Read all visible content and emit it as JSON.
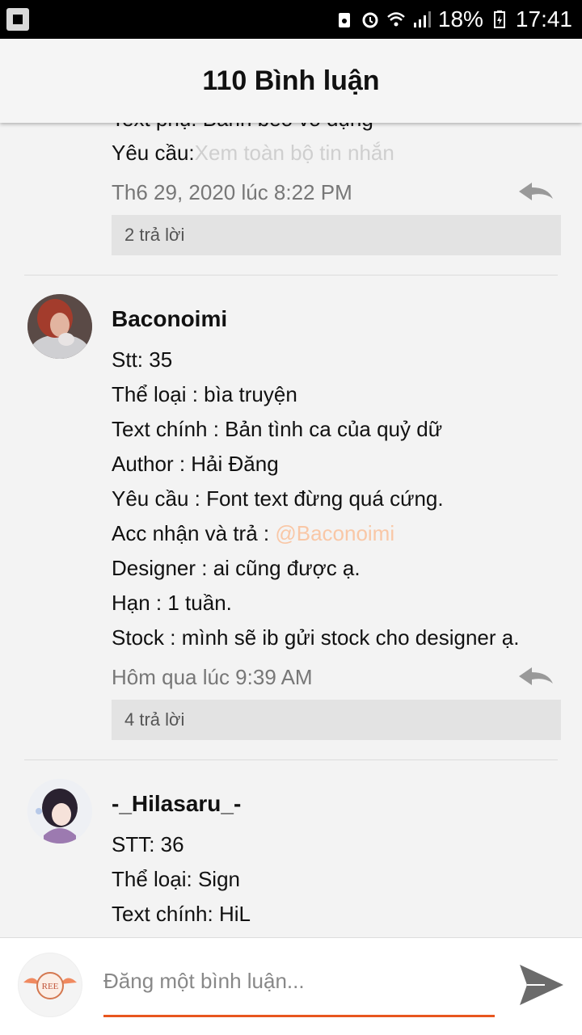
{
  "status_bar": {
    "battery": "18%",
    "time": "17:41"
  },
  "header": {
    "title": "110 Bình luận"
  },
  "comments": [
    {
      "partial_line": "Text phụ: Bánh bèo vô dụng",
      "request_label": "Yêu cầu:",
      "view_all": "Xem toàn bộ tin nhắn",
      "time": "Th6 29, 2020 lúc 8:22 PM",
      "replies": "2 trả lời"
    },
    {
      "user": "Baconoimi",
      "lines": [
        "Stt: 35",
        "Thể loại : bìa truyện",
        "Text chính : Bản tình ca của quỷ dữ",
        "Author : Hải Đăng",
        "Yêu cầu : Font text đừng quá cứng."
      ],
      "acc_label": "Acc nhận và trả : ",
      "mention": "@Baconoimi",
      "lines2": [
        "Designer : ai cũng được ạ.",
        "Hạn : 1 tuần.",
        "Stock : mình sẽ ib gửi stock cho designer ạ."
      ],
      "time": "Hôm qua lúc 9:39 AM",
      "replies": "4 trả lời"
    },
    {
      "user": "-_Hilasaru_-",
      "lines": [
        "STT: 36",
        "Thể loại: Sign",
        "Text chính: HiL"
      ]
    }
  ],
  "composer": {
    "placeholder": "Đăng một bình luận...",
    "avatar_text": "REE"
  },
  "colors": {
    "accent": "#e8561e",
    "mention": "#f9c7a6",
    "faded": "#cfcfcf"
  }
}
